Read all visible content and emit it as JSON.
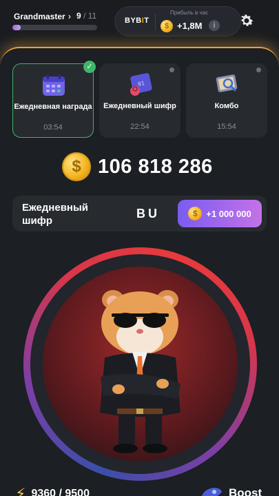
{
  "header": {
    "rank": "Grandmaster",
    "level_current": "9",
    "level_max": "/ 11",
    "progress_fraction": 0.1,
    "exchange": {
      "name_prefix": "BYB",
      "name_accent": "I",
      "name_suffix": "T"
    },
    "profit_label": "Прибыль в час",
    "profit_value": "+1,8M",
    "info_icon": "info-icon",
    "settings_icon": "gear-icon"
  },
  "cards": [
    {
      "title": "Ежедневная награда",
      "time": "03:54",
      "icon": "calendar-icon",
      "completed": true
    },
    {
      "title": "Ежедневный шифр",
      "time": "22:54",
      "icon": "cipher-lock-icon",
      "completed": false
    },
    {
      "title": "Комбо",
      "time": "15:54",
      "icon": "combo-card-icon",
      "completed": false
    }
  ],
  "balance": "106 818 286",
  "coin_symbol": "$",
  "cipher": {
    "label": "Ежедневный шифр",
    "code": "BU",
    "reward": "+1 000 000"
  },
  "energy": {
    "value": "9360 / 9500"
  },
  "boost": {
    "label": "Boost"
  },
  "colors": {
    "accent_orange": "#e8a33a",
    "success_green": "#3fb56b",
    "button_purple": "#7a5cf0"
  }
}
